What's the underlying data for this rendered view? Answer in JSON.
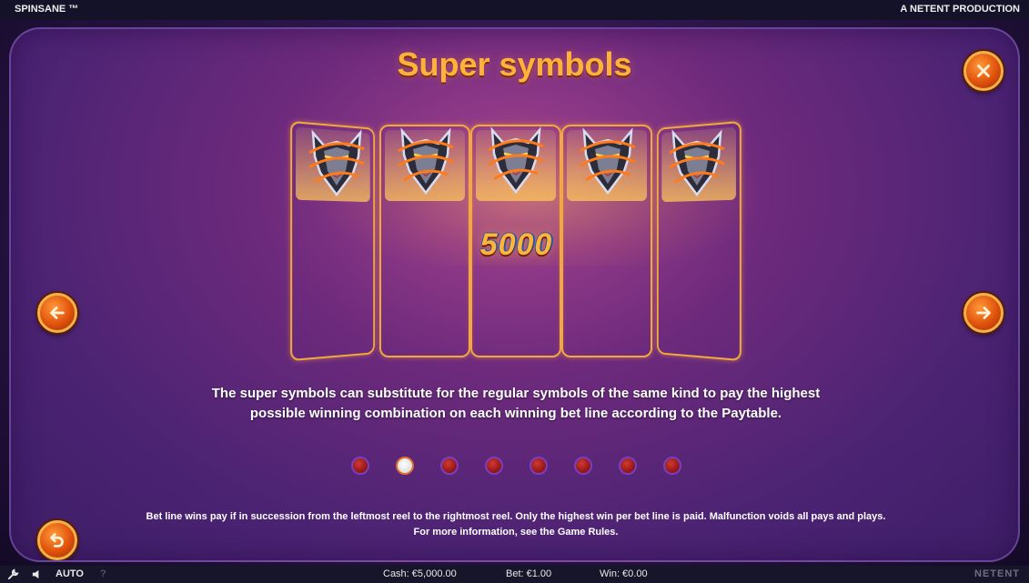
{
  "top_bar": {
    "game_title": "SPINSANE ™",
    "producer": "A NETENT PRODUCTION"
  },
  "page": {
    "title": "Super symbols",
    "win_value": "5000",
    "description_line1": "The super symbols can substitute for the regular symbols of the same kind to pay the highest",
    "description_line2": "possible winning combination on each winning bet line according to the Paytable.",
    "footnote_line1": "Bet line wins pay if in succession from the leftmost reel to the rightmost reel. Only the highest win per bet line is paid. Malfunction voids all pays and plays.",
    "footnote_line2": "For more information, see the Game Rules.",
    "pagination": {
      "total": 8,
      "active_index": 2
    },
    "symbol": "wolf-super-symbol",
    "reel_count": 5
  },
  "buttons": {
    "close": "close-icon",
    "previous": "arrow-left-icon",
    "next": "arrow-right-icon",
    "back": "return-icon"
  },
  "bottom_bar": {
    "auto_label": "AUTO",
    "help_label": "?",
    "cash": "Cash: €5,000.00",
    "bet": "Bet: €1.00",
    "win": "Win: €0.00",
    "brand": "NETENT"
  },
  "colors": {
    "accent": "#ffb23a",
    "button": "#e0520c",
    "panel": "#4b2373"
  }
}
